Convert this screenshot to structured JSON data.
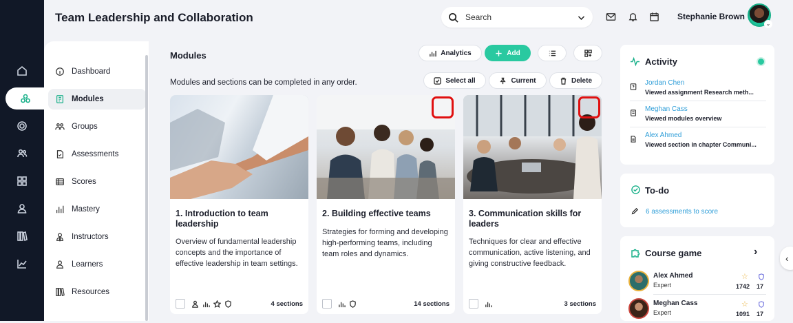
{
  "header": {
    "title": "Team Leadership and Collaboration",
    "search_placeholder": "Search",
    "user_name": "Stephanie Brown"
  },
  "rail": {
    "items": [
      "home-icon",
      "modules-icon",
      "target-icon",
      "people-icon",
      "grid-icon",
      "user-icon",
      "library-icon",
      "chart-icon"
    ],
    "active_index": 1
  },
  "sidebar": {
    "items": [
      {
        "label": "Dashboard",
        "icon": "info-icon"
      },
      {
        "label": "Modules",
        "icon": "book-icon",
        "active": true
      },
      {
        "label": "Groups",
        "icon": "groups-icon"
      },
      {
        "label": "Assessments",
        "icon": "document-icon"
      },
      {
        "label": "Scores",
        "icon": "table-icon"
      },
      {
        "label": "Mastery",
        "icon": "bars-icon"
      },
      {
        "label": "Instructors",
        "icon": "instructor-icon"
      },
      {
        "label": "Learners",
        "icon": "learner-icon"
      },
      {
        "label": "Resources",
        "icon": "library-icon"
      }
    ]
  },
  "main": {
    "heading": "Modules",
    "toolbar": {
      "analytics": "Analytics",
      "add": "Add"
    },
    "note": "Modules and sections can be completed in any order.",
    "actions": {
      "select_all": "Select all",
      "current": "Current",
      "delete": "Delete"
    },
    "cards": [
      {
        "title": "1. Introduction to team leadership",
        "desc": "Overview of fundamental leadership concepts and the importance of effective leadership in team settings.",
        "sections": "4 sections"
      },
      {
        "title": "2. Building effective teams",
        "desc": "Strategies for forming and developing high-performing teams, including team roles and dynamics.",
        "sections": "14 sections"
      },
      {
        "title": "3. Communication skills for leaders",
        "desc": "Techniques for clear and effective communication, active listening, and giving constructive feedback.",
        "sections": "3 sections"
      }
    ]
  },
  "activity": {
    "title": "Activity",
    "items": [
      {
        "name": "Jordan Chen",
        "desc": "Viewed assignment Research meth..."
      },
      {
        "name": "Meghan Cass",
        "desc": "Viewed modules overview"
      },
      {
        "name": "Alex Ahmed",
        "desc": "Viewed section in chapter Communi..."
      }
    ]
  },
  "todo": {
    "title": "To-do",
    "item": "6 assessments to score"
  },
  "game": {
    "title": "Course game",
    "players": [
      {
        "name": "Alex Ahmed",
        "level": "Expert",
        "score": "1742",
        "badges": "17"
      },
      {
        "name": "Meghan Cass",
        "level": "Expert",
        "score": "1091",
        "badges": "17"
      }
    ]
  },
  "colors": {
    "accent": "#29c9a0",
    "rail": "#111827",
    "link": "#2f9ed8",
    "highlight": "#e01010"
  }
}
